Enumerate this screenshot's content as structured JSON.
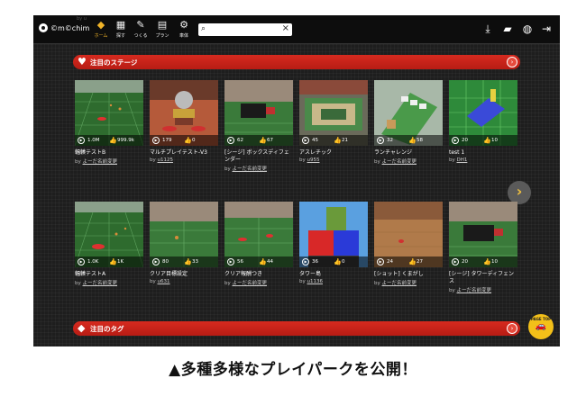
{
  "app": {
    "logo": "©m©chim",
    "ghost": "by u"
  },
  "nav": [
    {
      "label": "ホーム",
      "icon": "home-cube-icon",
      "glyph": "◆",
      "active": true
    },
    {
      "label": "探す",
      "icon": "map-icon",
      "glyph": "▦"
    },
    {
      "label": "つくる",
      "icon": "wrench-icon",
      "glyph": "✎"
    },
    {
      "label": "プラン",
      "icon": "clipboard-icon",
      "glyph": "▤"
    },
    {
      "label": "車体",
      "icon": "car-gear-icon",
      "glyph": "⚙"
    }
  ],
  "search": {
    "value": "",
    "placeholder": ""
  },
  "section1": {
    "title": "注目のステージ"
  },
  "section2": {
    "title": "注目のタグ"
  },
  "cards_row1": [
    {
      "name": "輻輳テストB",
      "by": "by",
      "author": "よーだ名前変更",
      "plays": "1.0M",
      "likes": "999.9k"
    },
    {
      "name": "マルチプレイテスト-V3",
      "by": "by",
      "author": "u1125",
      "plays": "179",
      "likes": "0"
    },
    {
      "name": "[シージ] ボックスディフェンダー",
      "by": "by",
      "author": "よーだ名前変更",
      "plays": "62",
      "likes": "67"
    },
    {
      "name": "アスレチック",
      "by": "by",
      "author": "u955",
      "plays": "45",
      "likes": "21"
    },
    {
      "name": "ランチャレンジ",
      "by": "by",
      "author": "よーだ名前変更",
      "plays": "32",
      "likes": "58"
    },
    {
      "name": "test 1",
      "by": "by",
      "author": "DH1",
      "plays": "20",
      "likes": "10"
    }
  ],
  "cards_row2": [
    {
      "name": "輻輳テストA",
      "by": "by",
      "author": "よーだ名前変更",
      "plays": "1.0K",
      "likes": "1K"
    },
    {
      "name": "クリア目標設定",
      "by": "by",
      "author": "u631",
      "plays": "80",
      "likes": "33"
    },
    {
      "name": "クリア報酬つき",
      "by": "by",
      "author": "よーだ名前変更",
      "plays": "56",
      "likes": "44"
    },
    {
      "name": "タワー島",
      "by": "by",
      "author": "u1136",
      "plays": "36",
      "likes": "0"
    },
    {
      "name": "[ショット] くまがし",
      "by": "by",
      "author": "よーだ名前変更",
      "plays": "24",
      "likes": "27"
    },
    {
      "name": "[シージ] タワーディフェンス",
      "by": "by",
      "author": "よーだ名前変更",
      "plays": "20",
      "likes": "10"
    }
  ],
  "badge": {
    "top": "PAGE TOP",
    "bottom": ""
  },
  "caption": "▲多種多様なプレイパークを公開！",
  "colors": {
    "accent": "#d62a1f",
    "active_nav": "#f0b429",
    "background": "#1e1e1e"
  }
}
